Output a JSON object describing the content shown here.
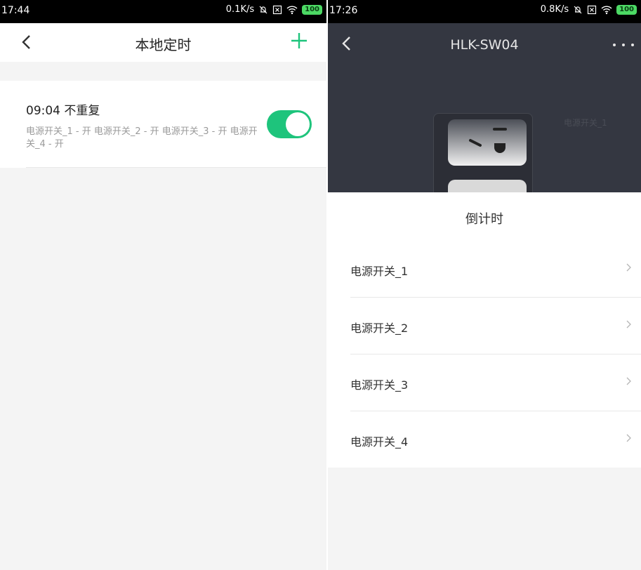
{
  "left": {
    "status": {
      "time": "17:44",
      "speed": "0.1K/s",
      "battery": "100"
    },
    "nav": {
      "title": "本地定时",
      "back_icon": "chevron-left-icon",
      "add_icon": "plus-icon",
      "accent": "#1ec47c"
    },
    "timer": {
      "title": "09:04 不重复",
      "desc": "电源开关_1 - 开 电源开关_2 - 开 电源开关_3 - 开 电源开关_4 - 开",
      "enabled": true
    }
  },
  "right": {
    "status": {
      "time": "17:26",
      "speed": "0.8K/s",
      "battery": "100"
    },
    "nav": {
      "title": "HLK-SW04",
      "back_icon": "chevron-left-icon",
      "more_icon": "more-dots-icon"
    },
    "device_label": "电源开关_1",
    "sheet": {
      "title": "倒计时",
      "items": [
        {
          "label": "电源开关_1"
        },
        {
          "label": "电源开关_2"
        },
        {
          "label": "电源开关_3"
        },
        {
          "label": "电源开关_4"
        }
      ]
    }
  }
}
